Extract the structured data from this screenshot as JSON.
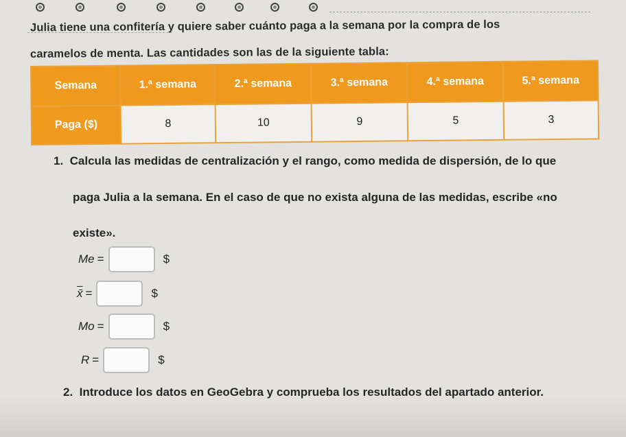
{
  "intro": {
    "line1": "Julia tiene una confitería y quiere saber cuánto paga a la semana por la compra de los",
    "line2": "caramelos de menta. Las cantidades son las de la siguiente tabla:"
  },
  "table": {
    "header_label": "Semana",
    "weeks": [
      "1.ª semana",
      "2.ª semana",
      "3.ª semana",
      "4.ª semana",
      "5.ª semana"
    ],
    "row_label": "Paga ($)",
    "values": [
      "8",
      "10",
      "9",
      "5",
      "3"
    ]
  },
  "question1": {
    "number": "1.",
    "line1": "Calcula las medidas de centralización y el rango, como medida de dispersión, de lo que",
    "line2": "paga Julia a la semana. En el caso de que no exista alguna de las medidas, escribe «no",
    "line3": "existe»."
  },
  "answers": [
    {
      "var": "Me",
      "eq": "=",
      "value": "",
      "unit": "$"
    },
    {
      "var": "x̄",
      "eq": "=",
      "value": "",
      "unit": "$"
    },
    {
      "var": "Mo",
      "eq": "=",
      "value": "",
      "unit": "$"
    },
    {
      "var": "R",
      "eq": "=",
      "value": "",
      "unit": "$"
    }
  ],
  "question2": {
    "number": "2.",
    "text": "Introduce los datos en GeoGebra y comprueba los resultados del apartado anterior."
  },
  "colors": {
    "table_header": "#ef9a1e",
    "table_border": "#e9a23b",
    "background": "#e4e2df"
  }
}
